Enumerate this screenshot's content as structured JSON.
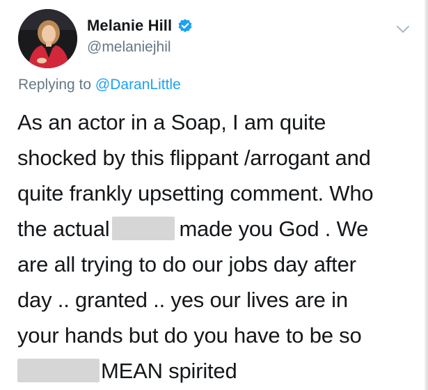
{
  "user": {
    "display_name": "Melanie Hill",
    "handle": "@melaniejhil",
    "verified": true,
    "avatar_icon": "profile-photo"
  },
  "reply": {
    "prefix": "Replying to",
    "to_handle": "@DaranLittle"
  },
  "tweet": {
    "lines": [
      [
        "As an actor in a Soap, I am quite"
      ],
      [
        "shocked by this flippant /arrogant and"
      ],
      [
        "quite frankly upsetting comment. Who"
      ],
      [
        "the actual",
        "made you God . We"
      ],
      [
        "are all trying to do our jobs day after"
      ],
      [
        "day .. granted .. yes our lives are in"
      ],
      [
        "your hands but do you have to be so"
      ],
      [
        "",
        "MEAN spirited"
      ]
    ]
  },
  "icons": {
    "verified": "verified-badge-icon",
    "more": "chevron-down-icon"
  },
  "colors": {
    "text": "#14171a",
    "secondary": "#657786",
    "link": "#1da1f2",
    "redaction": "#d6d6d6"
  }
}
